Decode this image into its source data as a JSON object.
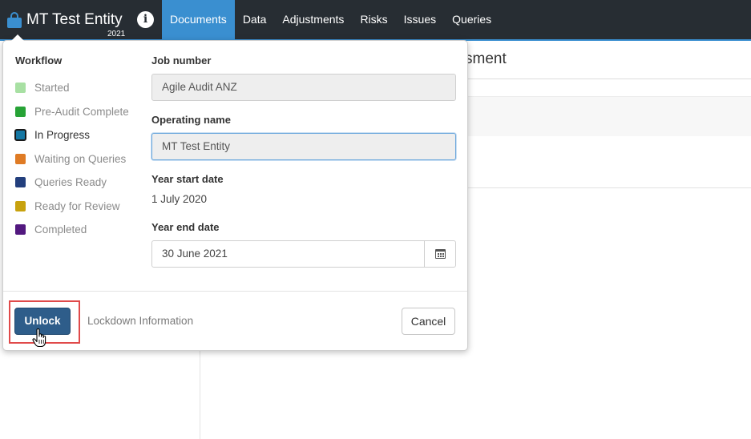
{
  "topbar": {
    "entity_name": "MT Test Entity",
    "year": "2021",
    "info_glyph": "i",
    "nav": [
      {
        "label": "Documents",
        "active": true
      },
      {
        "label": "Data",
        "active": false
      },
      {
        "label": "Adjustments",
        "active": false
      },
      {
        "label": "Risks",
        "active": false
      },
      {
        "label": "Issues",
        "active": false
      },
      {
        "label": "Queries",
        "active": false
      }
    ],
    "accent_color": "#3a8fd0",
    "bar_color": "#272d33"
  },
  "background_page": {
    "heading_fragment": "sment"
  },
  "popover": {
    "workflow": {
      "title": "Workflow",
      "items": [
        {
          "label": "Started",
          "color": "#a8e0a3",
          "current": false
        },
        {
          "label": "Pre-Audit Complete",
          "color": "#27a336",
          "current": false
        },
        {
          "label": "In Progress",
          "color": "#1577a3",
          "current": true
        },
        {
          "label": "Waiting on Queries",
          "color": "#df7b25",
          "current": false
        },
        {
          "label": "Queries Ready",
          "color": "#233f7d",
          "current": false
        },
        {
          "label": "Ready for Review",
          "color": "#c8a20e",
          "current": false
        },
        {
          "label": "Completed",
          "color": "#52187f",
          "current": false
        }
      ]
    },
    "fields": {
      "job_number_label": "Job number",
      "job_number_value": "Agile Audit ANZ",
      "operating_name_label": "Operating name",
      "operating_name_value": "MT Test Entity",
      "year_start_label": "Year start date",
      "year_start_value": "1 July 2020",
      "year_end_label": "Year end date",
      "year_end_value": "30 June 2021"
    },
    "footer": {
      "unlock_label": "Unlock",
      "lockdown_label": "Lockdown Information",
      "cancel_label": "Cancel"
    }
  },
  "icons": {
    "entity_lock": "lock-icon",
    "info": "info-icon",
    "calendar": "calendar-icon",
    "pointer": "hand-pointer-icon"
  }
}
